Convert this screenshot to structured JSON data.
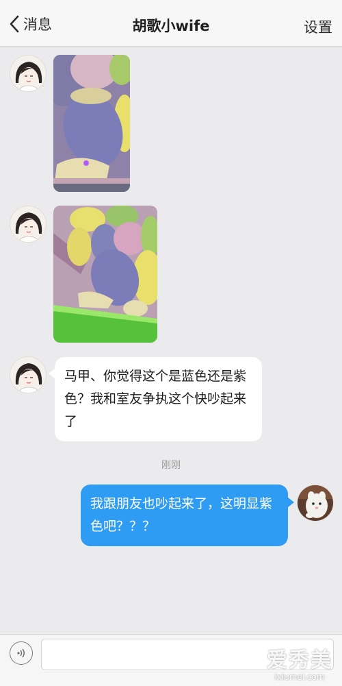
{
  "nav": {
    "back_label": "消息",
    "title": "胡歌小wife",
    "settings_label": "设置"
  },
  "messages": [
    {
      "type": "image",
      "side": "left",
      "sender": "胡歌小wife",
      "description": "claw machine plush toys"
    },
    {
      "type": "image",
      "side": "left",
      "sender": "胡歌小wife",
      "description": "claw machine plush toys, wider view"
    },
    {
      "type": "text",
      "side": "left",
      "sender": "胡歌小wife",
      "text": "马甲、你觉得这个是蓝色还是紫色？我和室友争执这个快吵起来了"
    },
    {
      "type": "text",
      "side": "right",
      "sender": "me",
      "text": "我跟朋友也吵起来了，这明显紫色吧？？？"
    }
  ],
  "timestamp": "刚刚",
  "input": {
    "placeholder": "",
    "value": ""
  },
  "icons": {
    "back": "chevron-left-icon",
    "voice": "voice-icon"
  },
  "colors": {
    "outgoing_bubble": "#2f9cf3",
    "incoming_bubble": "#ffffff",
    "background": "#ebebed"
  },
  "watermark": {
    "brand": "爱秀美",
    "url": "ixiumei.com"
  }
}
